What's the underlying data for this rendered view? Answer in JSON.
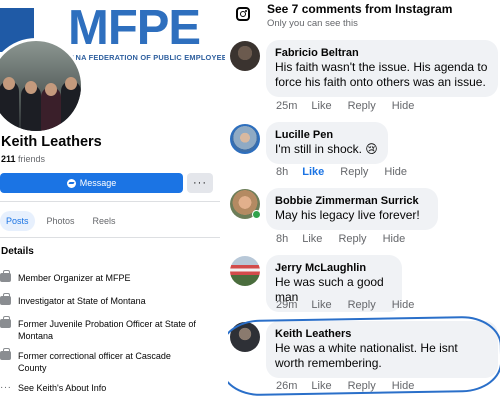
{
  "left": {
    "cover": {
      "title": "MFPE",
      "subtitle": "MONTANA FEDERATION OF PUBLIC EMPLOYEES"
    },
    "profile": {
      "name": "Keith Leathers",
      "friends_count": "211",
      "friends_label": "friends",
      "message_label": "Message",
      "more_label": "···"
    },
    "tabs": [
      {
        "label": "Posts",
        "active": true
      },
      {
        "label": "Photos",
        "active": false
      },
      {
        "label": "Reels",
        "active": false
      }
    ],
    "details_heading": "Details",
    "details": [
      {
        "icon": "briefcase-icon",
        "text": "Member Organizer at MFPE"
      },
      {
        "icon": "briefcase-icon",
        "text": "Investigator at State of Montana"
      },
      {
        "icon": "briefcase-icon",
        "text": "Former Juvenile Probation Officer at State of Montana"
      },
      {
        "icon": "briefcase-icon",
        "text": "Former correctional officer at Cascade County"
      },
      {
        "icon": "more-dots-icon",
        "text": "See Keith's About Info"
      }
    ]
  },
  "right": {
    "header": {
      "icon": "instagram-icon",
      "title": "See 7 comments from Instagram",
      "subtitle": "Only you can see this"
    },
    "comments": [
      {
        "name": "Fabricio Beltran",
        "text": "His faith wasn't the issue. His agenda to force his faith onto others was an issue.",
        "time": "25m",
        "like": "Like",
        "reply": "Reply",
        "hide": "Hide",
        "liked": false
      },
      {
        "name": "Lucille Pen",
        "text": "I'm still in shock. 😢",
        "time": "8h",
        "like": "Like",
        "reply": "Reply",
        "hide": "Hide",
        "liked": true
      },
      {
        "name": "Bobbie Zimmerman Surrick",
        "text": "May his legacy live forever!",
        "time": "8h",
        "like": "Like",
        "reply": "Reply",
        "hide": "Hide",
        "liked": false
      },
      {
        "name": "Jerry McLaughlin",
        "text": "He was such a good man",
        "time": "29m",
        "like": "Like",
        "reply": "Reply",
        "hide": "Hide",
        "liked": false
      },
      {
        "name": "Keith Leathers",
        "text": "He was a white nationalist.  He isnt worth remembering.",
        "time": "26m",
        "like": "Like",
        "reply": "Reply",
        "hide": "Hide",
        "liked": false
      }
    ]
  },
  "colors": {
    "brand_blue": "#1b74e4",
    "mfpe_blue": "#2e6fbe",
    "bubble_gray": "#f0f2f5",
    "meta_gray": "#65676b",
    "online_green": "#31a24c",
    "highlight_ring": "#2a6fc9"
  }
}
